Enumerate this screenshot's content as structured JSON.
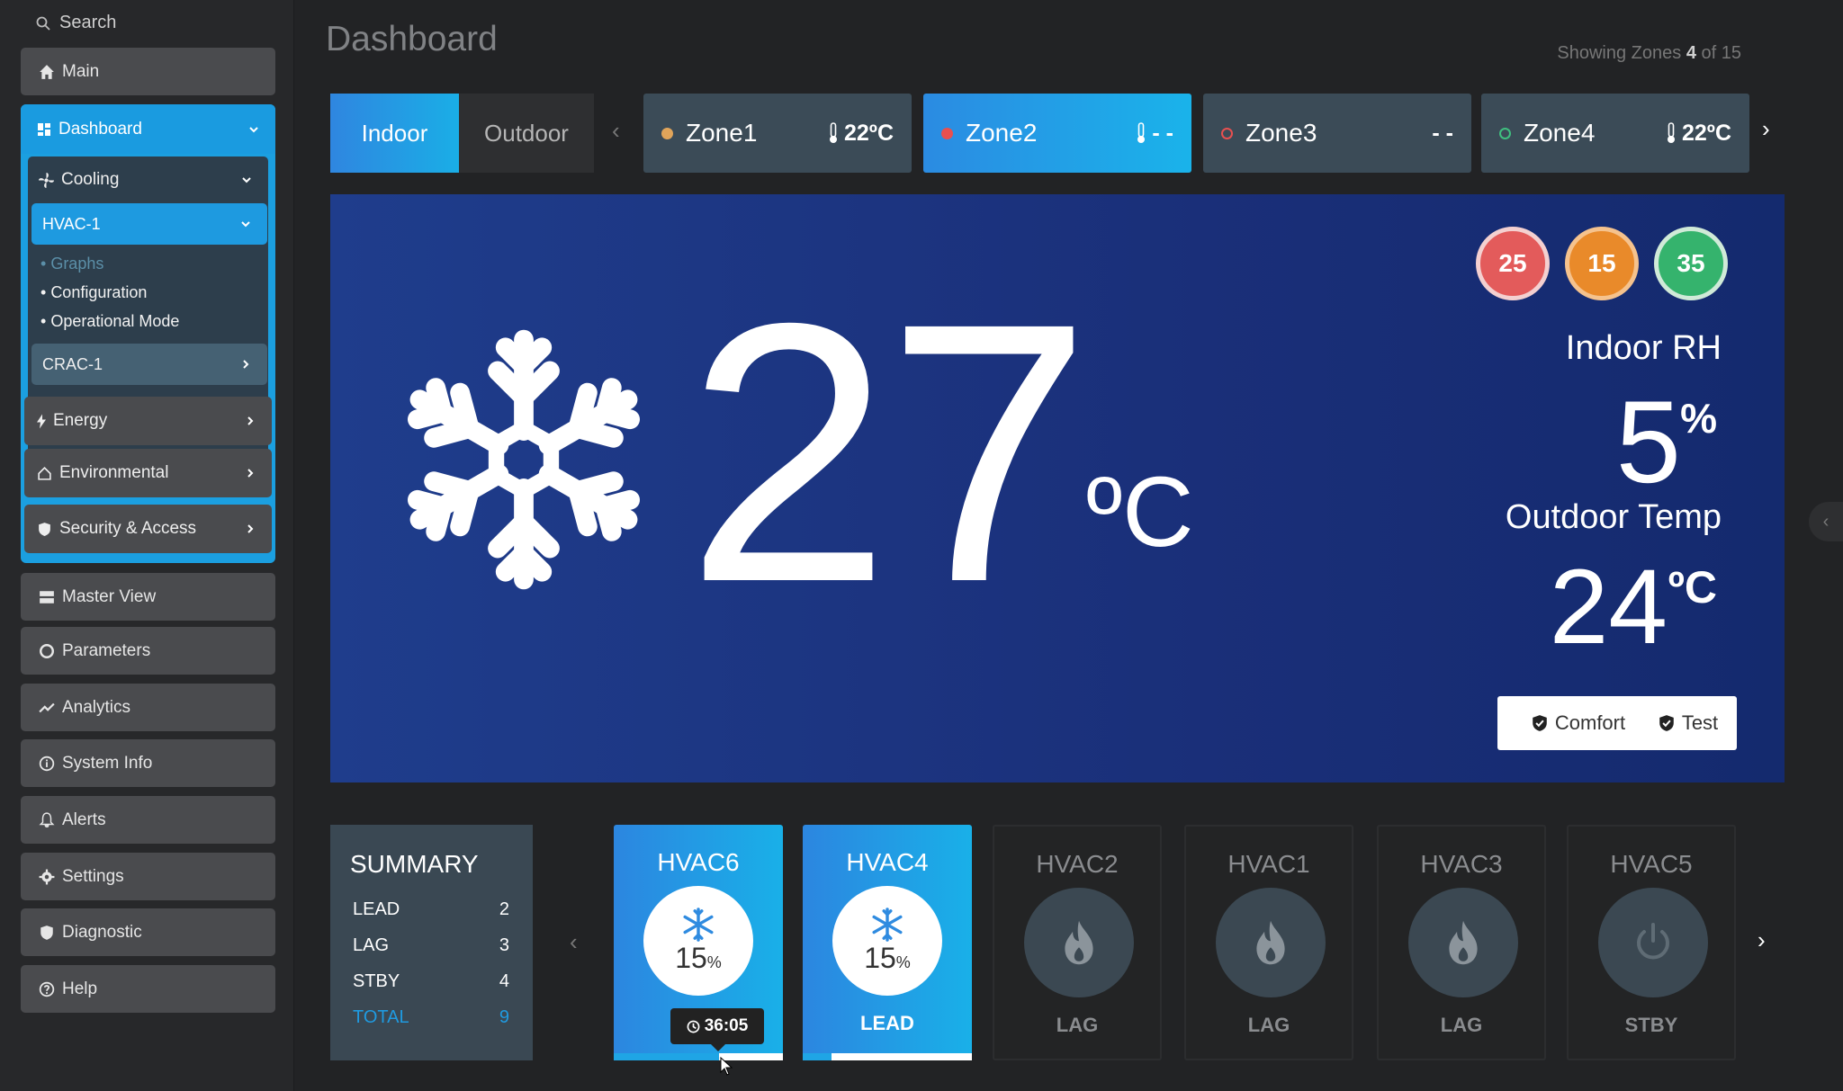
{
  "sidebar": {
    "search_label": "Search",
    "main": "Main",
    "dashboard": "Dashboard",
    "cooling": "Cooling",
    "hvac1": "HVAC-1",
    "hvac1_items": [
      "Graphs",
      "Configuration",
      "Operational Mode"
    ],
    "crac1": "CRAC-1",
    "groups": [
      "Energy",
      "Environmental",
      "Security & Access"
    ],
    "items": [
      "Master View",
      "Parameters",
      "Analytics",
      "System Info",
      "Alerts",
      "Settings",
      "Diagnostic",
      "Help"
    ]
  },
  "header": {
    "title": "Dashboard",
    "showing_prefix": "Showing Zones",
    "showing_count": "4",
    "showing_of": "of 15"
  },
  "tabs": {
    "indoor": "Indoor",
    "outdoor": "Outdoor"
  },
  "zones": [
    {
      "name": "Zone1",
      "temp": "22ºC",
      "dot": "#e0a45a",
      "style": "dark"
    },
    {
      "name": "Zone2",
      "temp": "- -",
      "dot": "#e85050",
      "style": "blue"
    },
    {
      "name": "Zone3",
      "temp": "- -",
      "dot": "#e85050",
      "style": "dark"
    },
    {
      "name": "Zone4",
      "temp": "22ºC",
      "dot": "#3fbf7f",
      "style": "dark"
    }
  ],
  "hero": {
    "temperature": "27",
    "unit": "ºC",
    "badges": [
      {
        "value": "25",
        "color": "#e35b5b"
      },
      {
        "value": "15",
        "color": "#e98a2a"
      },
      {
        "value": "35",
        "color": "#35b36d"
      }
    ],
    "rh_label": "Indoor RH",
    "rh_value": "5",
    "rh_unit": "%",
    "outdoor_label": "Outdoor Temp",
    "outdoor_value": "24",
    "outdoor_unit": "ºC",
    "comfort_label": "Comfort",
    "test_label": "Test"
  },
  "summary": {
    "title": "SUMMARY",
    "rows": [
      {
        "label": "LEAD",
        "value": "2"
      },
      {
        "label": "LAG",
        "value": "3"
      },
      {
        "label": "STBY",
        "value": "4"
      },
      {
        "label": "TOTAL",
        "value": "9"
      }
    ]
  },
  "units": [
    {
      "name": "HVAC6",
      "pct": "15",
      "status": "",
      "timer": "36:05",
      "active": true,
      "bar_fill": 0.62
    },
    {
      "name": "HVAC4",
      "pct": "15",
      "status": "LEAD",
      "active": true,
      "bar_fill": 0.17
    },
    {
      "name": "HVAC2",
      "status": "LAG",
      "active": false,
      "icon": "flame-icon"
    },
    {
      "name": "HVAC1",
      "status": "LAG",
      "active": false,
      "icon": "flame-icon"
    },
    {
      "name": "HVAC3",
      "status": "LAG",
      "active": false,
      "icon": "flame-icon"
    },
    {
      "name": "HVAC5",
      "status": "STBY",
      "active": false,
      "icon": "power-icon"
    }
  ],
  "colors": {
    "accent": "#1b9fe0",
    "hero_bg": "#1a2f79"
  }
}
